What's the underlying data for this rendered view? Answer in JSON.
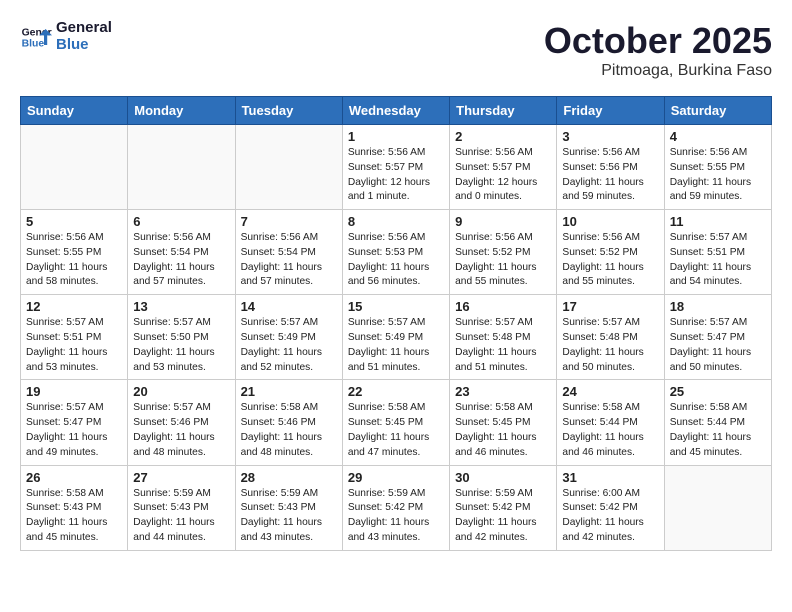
{
  "header": {
    "logo_line1": "General",
    "logo_line2": "Blue",
    "month": "October 2025",
    "location": "Pitmoaga, Burkina Faso"
  },
  "weekdays": [
    "Sunday",
    "Monday",
    "Tuesday",
    "Wednesday",
    "Thursday",
    "Friday",
    "Saturday"
  ],
  "weeks": [
    [
      {
        "day": "",
        "text": ""
      },
      {
        "day": "",
        "text": ""
      },
      {
        "day": "",
        "text": ""
      },
      {
        "day": "1",
        "text": "Sunrise: 5:56 AM\nSunset: 5:57 PM\nDaylight: 12 hours\nand 1 minute."
      },
      {
        "day": "2",
        "text": "Sunrise: 5:56 AM\nSunset: 5:57 PM\nDaylight: 12 hours\nand 0 minutes."
      },
      {
        "day": "3",
        "text": "Sunrise: 5:56 AM\nSunset: 5:56 PM\nDaylight: 11 hours\nand 59 minutes."
      },
      {
        "day": "4",
        "text": "Sunrise: 5:56 AM\nSunset: 5:55 PM\nDaylight: 11 hours\nand 59 minutes."
      }
    ],
    [
      {
        "day": "5",
        "text": "Sunrise: 5:56 AM\nSunset: 5:55 PM\nDaylight: 11 hours\nand 58 minutes."
      },
      {
        "day": "6",
        "text": "Sunrise: 5:56 AM\nSunset: 5:54 PM\nDaylight: 11 hours\nand 57 minutes."
      },
      {
        "day": "7",
        "text": "Sunrise: 5:56 AM\nSunset: 5:54 PM\nDaylight: 11 hours\nand 57 minutes."
      },
      {
        "day": "8",
        "text": "Sunrise: 5:56 AM\nSunset: 5:53 PM\nDaylight: 11 hours\nand 56 minutes."
      },
      {
        "day": "9",
        "text": "Sunrise: 5:56 AM\nSunset: 5:52 PM\nDaylight: 11 hours\nand 55 minutes."
      },
      {
        "day": "10",
        "text": "Sunrise: 5:56 AM\nSunset: 5:52 PM\nDaylight: 11 hours\nand 55 minutes."
      },
      {
        "day": "11",
        "text": "Sunrise: 5:57 AM\nSunset: 5:51 PM\nDaylight: 11 hours\nand 54 minutes."
      }
    ],
    [
      {
        "day": "12",
        "text": "Sunrise: 5:57 AM\nSunset: 5:51 PM\nDaylight: 11 hours\nand 53 minutes."
      },
      {
        "day": "13",
        "text": "Sunrise: 5:57 AM\nSunset: 5:50 PM\nDaylight: 11 hours\nand 53 minutes."
      },
      {
        "day": "14",
        "text": "Sunrise: 5:57 AM\nSunset: 5:49 PM\nDaylight: 11 hours\nand 52 minutes."
      },
      {
        "day": "15",
        "text": "Sunrise: 5:57 AM\nSunset: 5:49 PM\nDaylight: 11 hours\nand 51 minutes."
      },
      {
        "day": "16",
        "text": "Sunrise: 5:57 AM\nSunset: 5:48 PM\nDaylight: 11 hours\nand 51 minutes."
      },
      {
        "day": "17",
        "text": "Sunrise: 5:57 AM\nSunset: 5:48 PM\nDaylight: 11 hours\nand 50 minutes."
      },
      {
        "day": "18",
        "text": "Sunrise: 5:57 AM\nSunset: 5:47 PM\nDaylight: 11 hours\nand 50 minutes."
      }
    ],
    [
      {
        "day": "19",
        "text": "Sunrise: 5:57 AM\nSunset: 5:47 PM\nDaylight: 11 hours\nand 49 minutes."
      },
      {
        "day": "20",
        "text": "Sunrise: 5:57 AM\nSunset: 5:46 PM\nDaylight: 11 hours\nand 48 minutes."
      },
      {
        "day": "21",
        "text": "Sunrise: 5:58 AM\nSunset: 5:46 PM\nDaylight: 11 hours\nand 48 minutes."
      },
      {
        "day": "22",
        "text": "Sunrise: 5:58 AM\nSunset: 5:45 PM\nDaylight: 11 hours\nand 47 minutes."
      },
      {
        "day": "23",
        "text": "Sunrise: 5:58 AM\nSunset: 5:45 PM\nDaylight: 11 hours\nand 46 minutes."
      },
      {
        "day": "24",
        "text": "Sunrise: 5:58 AM\nSunset: 5:44 PM\nDaylight: 11 hours\nand 46 minutes."
      },
      {
        "day": "25",
        "text": "Sunrise: 5:58 AM\nSunset: 5:44 PM\nDaylight: 11 hours\nand 45 minutes."
      }
    ],
    [
      {
        "day": "26",
        "text": "Sunrise: 5:58 AM\nSunset: 5:43 PM\nDaylight: 11 hours\nand 45 minutes."
      },
      {
        "day": "27",
        "text": "Sunrise: 5:59 AM\nSunset: 5:43 PM\nDaylight: 11 hours\nand 44 minutes."
      },
      {
        "day": "28",
        "text": "Sunrise: 5:59 AM\nSunset: 5:43 PM\nDaylight: 11 hours\nand 43 minutes."
      },
      {
        "day": "29",
        "text": "Sunrise: 5:59 AM\nSunset: 5:42 PM\nDaylight: 11 hours\nand 43 minutes."
      },
      {
        "day": "30",
        "text": "Sunrise: 5:59 AM\nSunset: 5:42 PM\nDaylight: 11 hours\nand 42 minutes."
      },
      {
        "day": "31",
        "text": "Sunrise: 6:00 AM\nSunset: 5:42 PM\nDaylight: 11 hours\nand 42 minutes."
      },
      {
        "day": "",
        "text": ""
      }
    ]
  ]
}
